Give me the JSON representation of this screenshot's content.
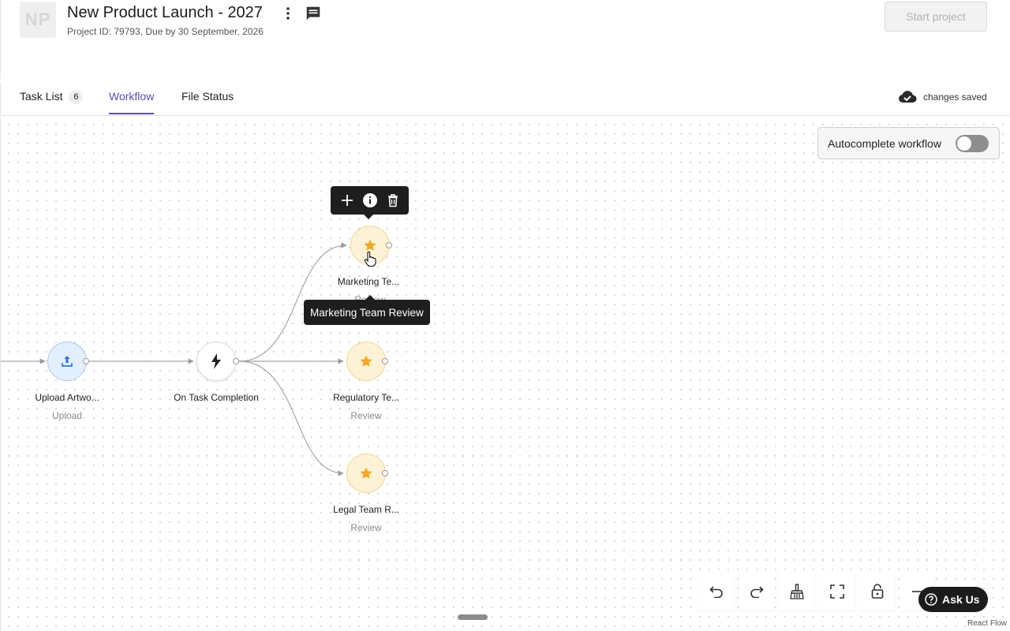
{
  "project": {
    "avatar_initials": "NP",
    "title": "New Product Launch - 2027",
    "subtitle": "Project ID: 79793, Due by 30 September, 2026",
    "start_button": "Start project"
  },
  "tabs": [
    {
      "label": "Task List",
      "count": "6"
    },
    {
      "label": "Workflow"
    },
    {
      "label": "File Status"
    }
  ],
  "save_status": "changes saved",
  "autocomplete": {
    "label": "Autocomplete workflow",
    "enabled": false
  },
  "nodes": {
    "upload": {
      "label": "Upload Artwo...",
      "type": "Upload"
    },
    "trigger": {
      "label": "On Task Completion"
    },
    "marketing": {
      "label": "Marketing Te...",
      "type": "Review"
    },
    "regulatory": {
      "label": "Regulatory Te...",
      "type": "Review"
    },
    "legal": {
      "label": "Legal Team R...",
      "type": "Review"
    }
  },
  "tooltip": "Marketing Team Review",
  "ask_us": "Ask Us",
  "attribution": "React Flow",
  "colors": {
    "accent": "#5b4bc4",
    "review_icon": "#f0a928",
    "upload_icon": "#2f6fd6"
  }
}
